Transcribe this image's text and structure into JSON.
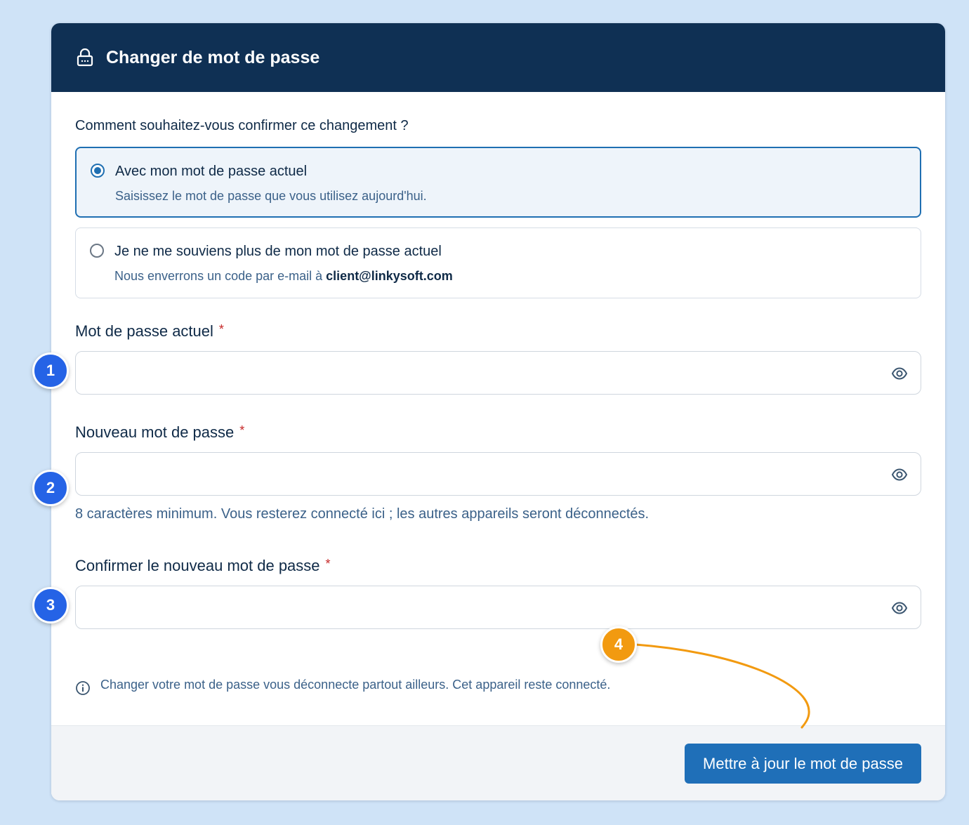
{
  "header": {
    "title": "Changer de mot de passe",
    "icon": "lock-icon",
    "bg_color": "#0f3054"
  },
  "confirm": {
    "question": "Comment souhaitez-vous confirmer ce changement ?",
    "options": [
      {
        "label": "Avec mon mot de passe actuel",
        "description": "Saisissez le mot de passe que vous utilisez aujourd'hui.",
        "selected": true
      },
      {
        "label": "Je ne me souviens plus de mon mot de passe actuel",
        "description_prefix": "Nous enverrons un code par e-mail à ",
        "email": "client@linkysoft.com",
        "selected": false
      }
    ]
  },
  "fields": {
    "current_password": {
      "label": "Mot de passe actuel",
      "required": "*",
      "value": ""
    },
    "new_password": {
      "label": "Nouveau mot de passe",
      "required": "*",
      "value": ""
    },
    "new_password_hint": "8 caractères minimum. Vous resterez connecté ici ; les autres appareils seront déconnectés.",
    "confirm_password": {
      "label": "Confirmer le nouveau mot de passe",
      "required": "*",
      "value": ""
    }
  },
  "info": {
    "icon": "info-icon",
    "text": "Changer votre mot de passe vous déconnecte partout ailleurs. Cet appareil reste connecté."
  },
  "footer": {
    "submit_label": "Mettre à jour le mot de passe",
    "accent": "#1f6fb8"
  },
  "markers": [
    "1",
    "2",
    "3",
    "4"
  ],
  "colors": {
    "page_bg": "#cfe3f7",
    "marker_blue": "#2563e6",
    "marker_orange": "#f29a10",
    "required": "#c62828"
  }
}
